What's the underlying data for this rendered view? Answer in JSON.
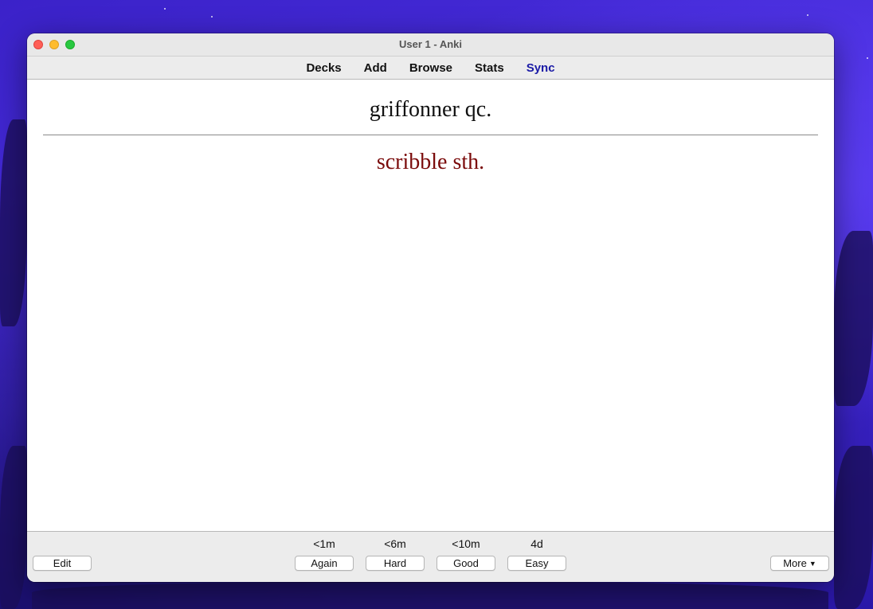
{
  "window": {
    "title": "User 1 - Anki"
  },
  "toolbar": {
    "decks": "Decks",
    "add": "Add",
    "browse": "Browse",
    "stats": "Stats",
    "sync": "Sync"
  },
  "card": {
    "front": "griffonner qc.",
    "back": "scribble sth."
  },
  "bottom": {
    "edit": "Edit",
    "more": "More",
    "answers": [
      {
        "interval": "<1m",
        "label": "Again"
      },
      {
        "interval": "<6m",
        "label": "Hard"
      },
      {
        "interval": "<10m",
        "label": "Good"
      },
      {
        "interval": "4d",
        "label": "Easy"
      }
    ]
  },
  "colors": {
    "sync_link": "#1a1aa6",
    "answer_text": "#7a0a0a"
  }
}
